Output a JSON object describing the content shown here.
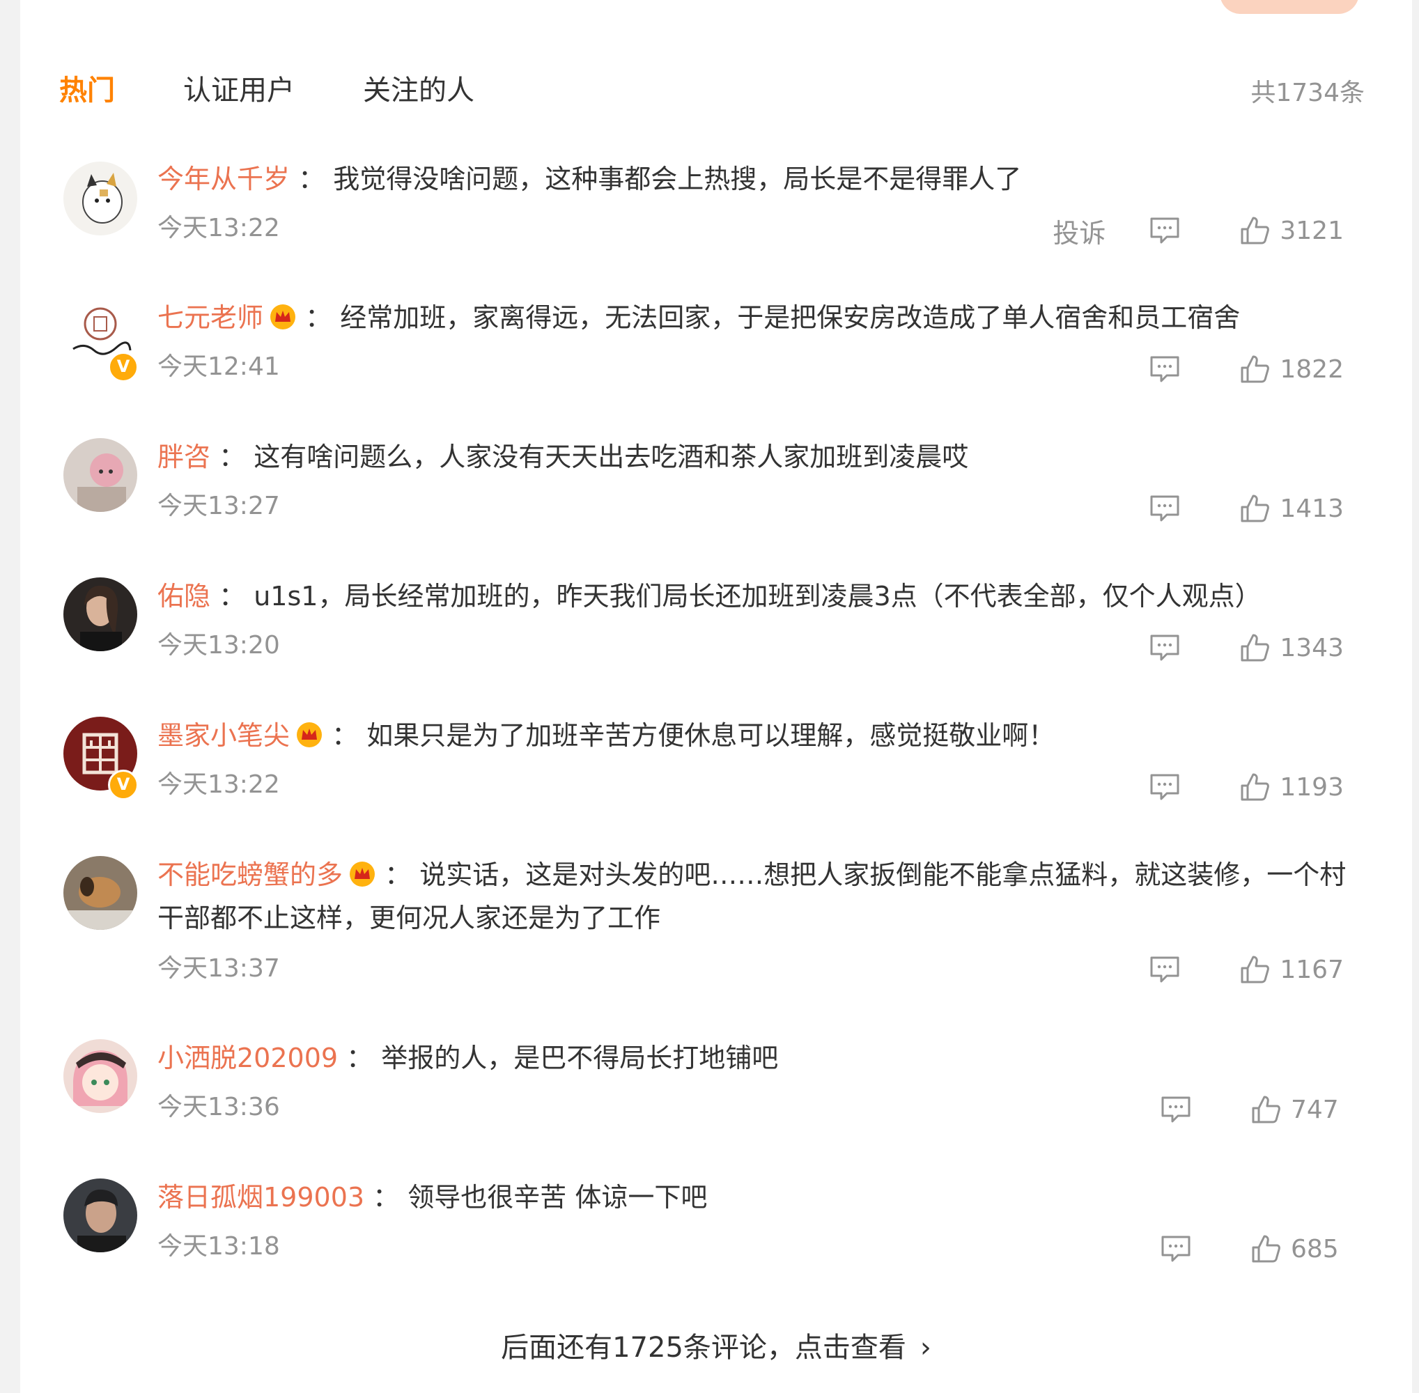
{
  "tabs": {
    "hot": "热门",
    "verified": "认证用户",
    "following": "关注的人",
    "total": "共1734条"
  },
  "colors": {
    "accent": "#ff8200",
    "username": "#eb7350",
    "muted": "#939393",
    "badge": "#ffab0a"
  },
  "comments": [
    {
      "user": "今年从千岁",
      "colon": "：",
      "text": "我觉得没啥问题，这种事都会上热搜，局长是不是得罪人了",
      "time": "今天13:22",
      "report": "投诉",
      "likes": "3121"
    },
    {
      "user": "七元老师",
      "colon": "：",
      "text": "经常加班，家离得远，无法回家，于是把保安房改造成了单人宿舍和员工宿舍",
      "time": "今天12:41",
      "likes": "1822"
    },
    {
      "user": "胖咨",
      "colon": "：",
      "text": "这有啥问题么，人家没有天天出去吃酒和茶人家加班到凌晨哎",
      "time": "今天13:27",
      "likes": "1413"
    },
    {
      "user": "佑隐",
      "colon": "：",
      "text": "u1s1，局长经常加班的，昨天我们局长还加班到凌晨3点（不代表全部，仅个人观点）",
      "time": "今天13:20",
      "likes": "1343"
    },
    {
      "user": "墨家小笔尖",
      "colon": "：",
      "text": "如果只是为了加班辛苦方便休息可以理解，感觉挺敬业啊！",
      "time": "今天13:22",
      "likes": "1193"
    },
    {
      "user": "不能吃螃蟹的多",
      "colon": "：",
      "text": "说实话，这是对头发的吧……想把人家扳倒能不能拿点猛料，就这装修，一个村干部都不止这样，更何况人家还是为了工作",
      "time": "今天13:37",
      "likes": "1167"
    },
    {
      "user": "小洒脱202009",
      "colon": "：",
      "text": "举报的人，是巴不得局长打地铺吧",
      "time": "今天13:36",
      "likes": "747"
    },
    {
      "user": "落日孤烟199003",
      "colon": "：",
      "text": "领导也很辛苦 体谅一下吧",
      "time": "今天13:18",
      "likes": "685"
    }
  ],
  "more": {
    "label": "后面还有1725条评论，点击查看",
    "chevron": "›"
  },
  "icons": [
    "reply-icon",
    "thumbs-up-icon",
    "crown-badge-icon",
    "verified-badge-icon",
    "chevron-right-icon"
  ]
}
